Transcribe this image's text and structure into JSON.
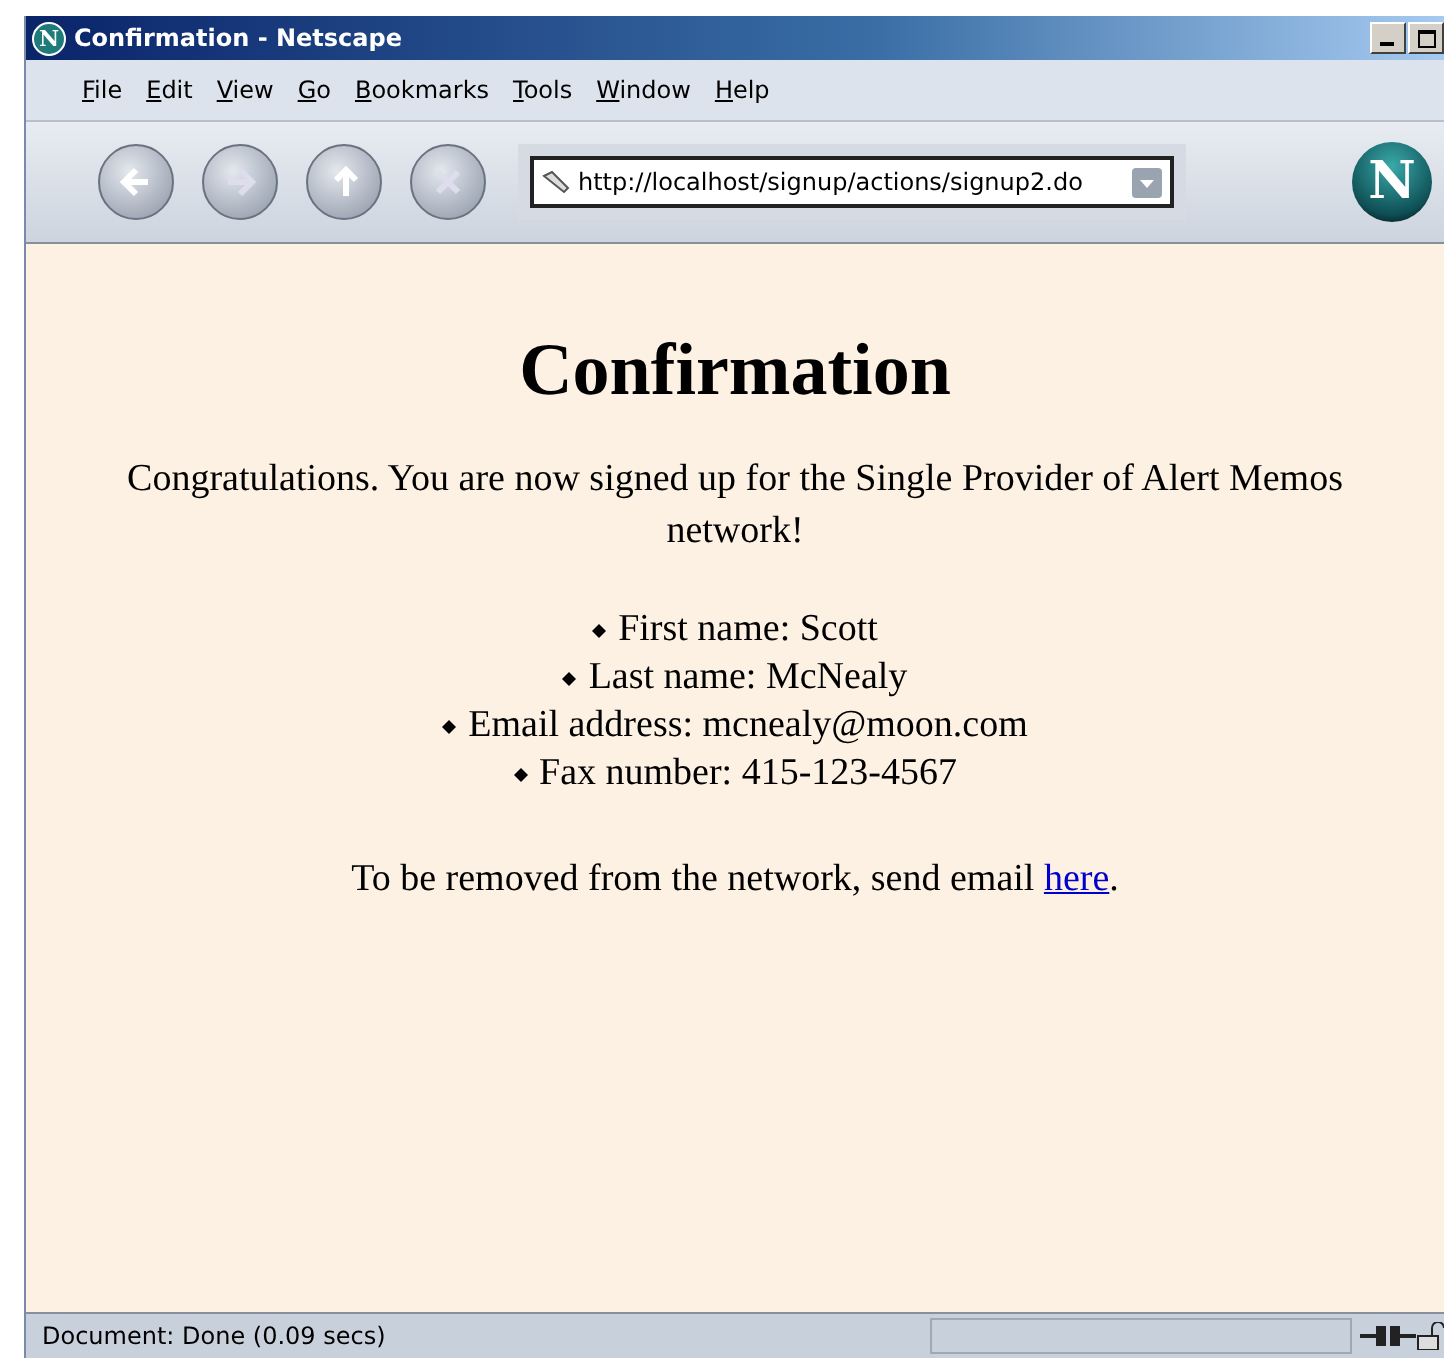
{
  "window": {
    "title": "Confirmation - Netscape",
    "logo": "N"
  },
  "menu": [
    "File",
    "Edit",
    "View",
    "Go",
    "Bookmarks",
    "Tools",
    "Window",
    "Help"
  ],
  "toolbar": {
    "url": "http://localhost/signup/actions/signup2.do",
    "throbber": "N"
  },
  "page": {
    "heading": "Confirmation",
    "intro": "Congratulations. You are now signed up for the Single Provider of Alert Memos network!",
    "items": [
      "First name: Scott",
      "Last name: McNealy",
      "Email address: mcnealy@moon.com",
      "Fax number: 415-123-4567"
    ],
    "footer_before": "To be removed from the network, send email",
    "footer_link": "here",
    "footer_after": "."
  },
  "status_bar": {
    "text": "Document: Done (0.09 secs)"
  }
}
